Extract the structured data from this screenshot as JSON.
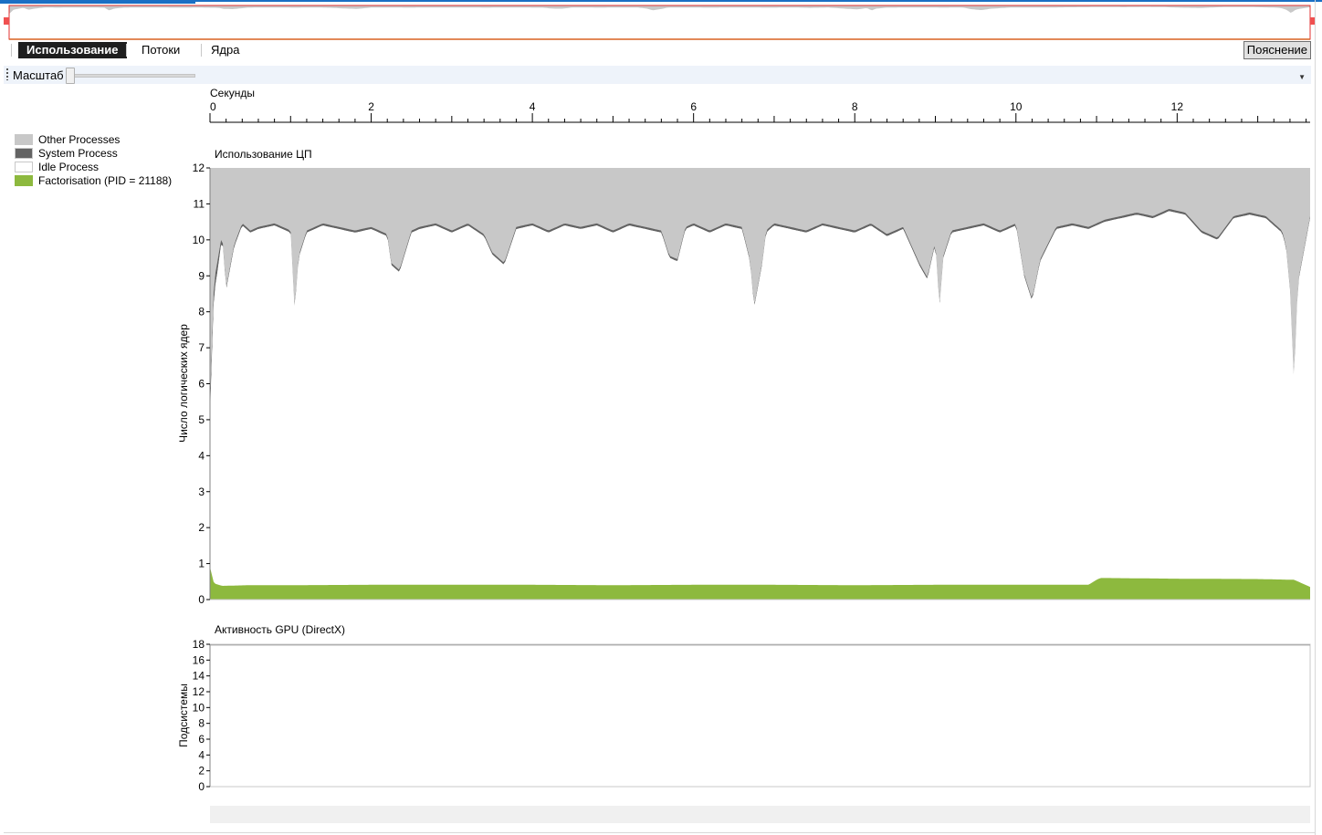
{
  "tabs": [
    {
      "label": "Использование",
      "active": true
    },
    {
      "label": "Потоки",
      "active": false
    },
    {
      "label": "Ядра",
      "active": false
    }
  ],
  "explain_button": "Пояснение",
  "zoom": {
    "label": "Масштаб",
    "value": 0
  },
  "legend": [
    {
      "label": "Other Processes",
      "color": "#c8c8c8"
    },
    {
      "label": "System Process",
      "color": "#636363"
    },
    {
      "label": "Idle Process",
      "color": "#ffffff"
    },
    {
      "label": "Factorisation (PID = 21188)",
      "color": "#8db93e"
    }
  ],
  "chart_data": [
    {
      "type": "area",
      "title": "Использование ЦП",
      "xlabel": "Секунды",
      "ylabel": "Число логических ядер",
      "x_ticks": [
        0,
        2,
        4,
        6,
        8,
        10,
        12
      ],
      "xlim": [
        0,
        13.65
      ],
      "y_ticks": [
        0,
        1,
        2,
        3,
        4,
        5,
        6,
        7,
        8,
        9,
        10,
        11,
        12
      ],
      "ylim": [
        0,
        12
      ],
      "grid": false,
      "stacked": true,
      "series": [
        {
          "name": "Factorisation (PID = 21188)",
          "color": "#8db93e",
          "x": [
            0,
            0.05,
            0.15,
            0.5,
            1,
            2,
            3,
            4,
            5,
            6,
            7,
            8,
            9,
            10,
            10.9,
            11,
            11.05,
            12,
            13,
            13.45,
            13.65
          ],
          "values": [
            0.9,
            0.45,
            0.38,
            0.4,
            0.4,
            0.41,
            0.41,
            0.41,
            0.4,
            0.41,
            0.41,
            0.4,
            0.41,
            0.41,
            0.41,
            0.55,
            0.6,
            0.58,
            0.57,
            0.55,
            0.35
          ]
        },
        {
          "name": "Idle Process",
          "color": "#ffffff",
          "x": [
            0,
            0.05,
            0.1,
            0.15,
            0.2,
            0.3,
            0.4,
            0.5,
            0.6,
            0.8,
            1.0,
            1.05,
            1.1,
            1.2,
            1.4,
            1.6,
            1.8,
            2.0,
            2.2,
            2.25,
            2.35,
            2.5,
            2.6,
            2.8,
            3.0,
            3.2,
            3.4,
            3.5,
            3.65,
            3.8,
            4.0,
            4.2,
            4.4,
            4.6,
            4.8,
            5.0,
            5.2,
            5.4,
            5.6,
            5.7,
            5.8,
            5.9,
            6.0,
            6.2,
            6.4,
            6.6,
            6.7,
            6.75,
            6.85,
            6.9,
            7.0,
            7.2,
            7.4,
            7.6,
            7.8,
            8.0,
            8.2,
            8.4,
            8.6,
            8.8,
            8.9,
            9.0,
            9.05,
            9.1,
            9.2,
            9.4,
            9.6,
            9.8,
            10.0,
            10.1,
            10.2,
            10.3,
            10.5,
            10.7,
            10.9,
            11.1,
            11.3,
            11.5,
            11.7,
            11.9,
            12.1,
            12.3,
            12.5,
            12.7,
            12.9,
            13.1,
            13.3,
            13.35,
            13.4,
            13.45,
            13.5,
            13.65
          ],
          "values": [
            5.1,
            8.5,
            9.2,
            10.1,
            8.6,
            9.8,
            10.4,
            10.2,
            10.3,
            10.4,
            10.2,
            8.0,
            9.5,
            10.2,
            10.4,
            10.3,
            10.2,
            10.3,
            10.1,
            9.3,
            9.1,
            10.2,
            10.3,
            10.4,
            10.2,
            10.4,
            10.1,
            9.6,
            9.3,
            10.3,
            10.4,
            10.2,
            10.4,
            10.3,
            10.4,
            10.2,
            10.4,
            10.3,
            10.2,
            9.5,
            9.4,
            10.3,
            10.4,
            10.2,
            10.4,
            10.3,
            9.4,
            8.1,
            9.3,
            10.2,
            10.4,
            10.3,
            10.2,
            10.4,
            10.3,
            10.2,
            10.4,
            10.1,
            10.3,
            9.3,
            8.9,
            9.9,
            8.1,
            9.5,
            10.2,
            10.3,
            10.4,
            10.2,
            10.4,
            9.0,
            8.3,
            9.4,
            10.3,
            10.4,
            10.3,
            10.5,
            10.6,
            10.7,
            10.6,
            10.8,
            10.7,
            10.2,
            10.0,
            10.6,
            10.7,
            10.6,
            10.2,
            9.8,
            8.6,
            6.0,
            8.8,
            10.6
          ]
        },
        {
          "name": "System Process",
          "color": "#636363",
          "x": [
            0,
            0.1,
            0.15,
            0.5,
            13.65
          ],
          "values": [
            0.4,
            0.3,
            0.08,
            0.06,
            0.06
          ]
        },
        {
          "name": "Other Processes",
          "color": "#c8c8c8",
          "fill_to": 12
        }
      ]
    },
    {
      "type": "line",
      "title": "Активность GPU (DirectX)",
      "ylabel": "Подсистемы",
      "y_ticks": [
        0,
        2,
        4,
        6,
        8,
        10,
        12,
        14,
        16,
        18
      ],
      "ylim": [
        0,
        18
      ],
      "xlim": [
        0,
        13.65
      ],
      "grid": false,
      "series": [
        {
          "color": "#a0a0a0",
          "x": [
            0,
            13.65
          ],
          "values": [
            17.9,
            17.9
          ]
        }
      ]
    }
  ]
}
